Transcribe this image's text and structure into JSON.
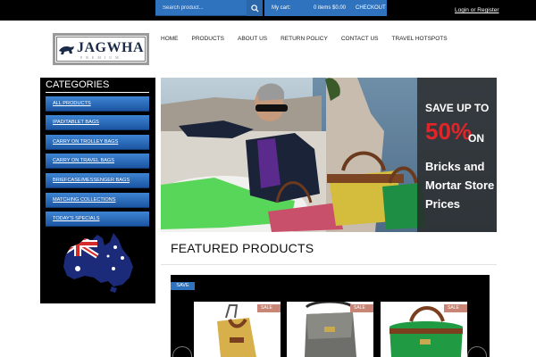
{
  "topbar": {
    "search_placeholder": "Search product...",
    "cart_label": "My cart:",
    "cart_items": "0 items $0.00",
    "checkout_label": "CHECKOUT",
    "login_label": "Login or Register"
  },
  "logo": {
    "text": "JAGWHA",
    "subtitle": "PREMIUM"
  },
  "nav": {
    "items": [
      "HOME",
      "PRODUCTS",
      "ABOUT US",
      "RETURN POLICY",
      "CONTACT US",
      "TRAVEL HOTSPOTS"
    ]
  },
  "sidebar": {
    "title": "CATEGORIES",
    "items": [
      "ALL PRODUCTS",
      "IPAD/TABLET BAGS",
      "CARRY ON TROLLEY BAGS",
      "CARRY ON TRAVEL BAGS",
      "BRIEFCASE/MESSENGER BAGS",
      "MATCHING COLLECTIONS",
      "TODAY'S SPECIALS"
    ]
  },
  "banner": {
    "line1": "SAVE UP TO",
    "percent": "50%",
    "on": "ON",
    "line2": "Bricks and",
    "line3": "Mortar Store",
    "line4": "Prices"
  },
  "featured": {
    "title": "FEATURED PRODUCTS",
    "save_badge": "SAVE",
    "card_badges": [
      "SALE",
      "SALE",
      "SALE"
    ]
  },
  "colors": {
    "topbar_bg": "#000000",
    "accent_blue": "#2f72bd",
    "promo_red": "#e0262a",
    "sale_badge": "#c98576"
  },
  "icons": [
    "search-icon",
    "australia-flag-map-icon",
    "carousel-prev-icon",
    "carousel-next-icon"
  ]
}
